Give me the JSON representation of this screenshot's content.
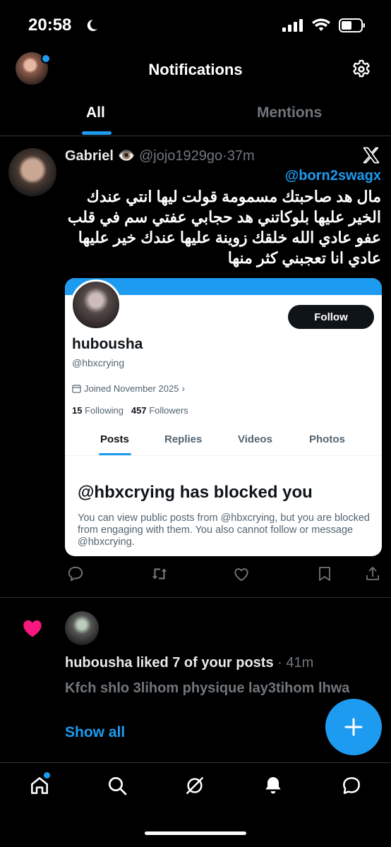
{
  "status_bar": {
    "time": "20:58"
  },
  "header": {
    "title": "Notifications"
  },
  "tabs": [
    {
      "label": "All"
    },
    {
      "label": "Mentions"
    }
  ],
  "tweet": {
    "name": "Gabriel",
    "emoji": "👁️",
    "handle": "@jojo1929go",
    "time": "37m",
    "reply_to": "@born2swagx",
    "text": "مال هد صاحبتك مسمومة قولت ليها انتي عندك الخير عليها بلوكاتني هد حجابي عفتي سم في قلب عفو عادي الله خلقك زوينة عليها عندك خير عليها عادي انا تعجبني كثر منها"
  },
  "card": {
    "follow_label": "Follow",
    "name": "hubousha",
    "handle": "@hbxcrying",
    "joined": "Joined November 2025",
    "following_count": "15",
    "following_label": "Following",
    "followers_count": "457",
    "followers_label": "Followers",
    "tabs": [
      "Posts",
      "Replies",
      "Videos",
      "Photos"
    ],
    "blocked_title": "@hbxcrying has blocked you",
    "blocked_desc": "You can view public posts from @hbxcrying, but you are blocked from engaging with them. You also cannot follow or message @hbxcrying."
  },
  "notification": {
    "actor": "hubousha",
    "action": "liked 7 of your posts",
    "time": "41m",
    "text": "Kfch shlo 3lihom physique lay3tihom lhwa",
    "show_all": "Show all"
  },
  "colors": {
    "accent": "#1d9bf0",
    "like": "#f91880",
    "muted": "#71767b"
  },
  "icons": [
    "moon-icon",
    "signal-icon",
    "wifi-icon",
    "battery-icon",
    "gear-icon",
    "x-logo-icon",
    "reply-icon",
    "repost-icon",
    "like-icon",
    "bookmark-icon",
    "share-icon",
    "heart-icon",
    "plus-icon",
    "home-icon",
    "search-icon",
    "grok-icon",
    "bell-icon",
    "messages-icon"
  ]
}
